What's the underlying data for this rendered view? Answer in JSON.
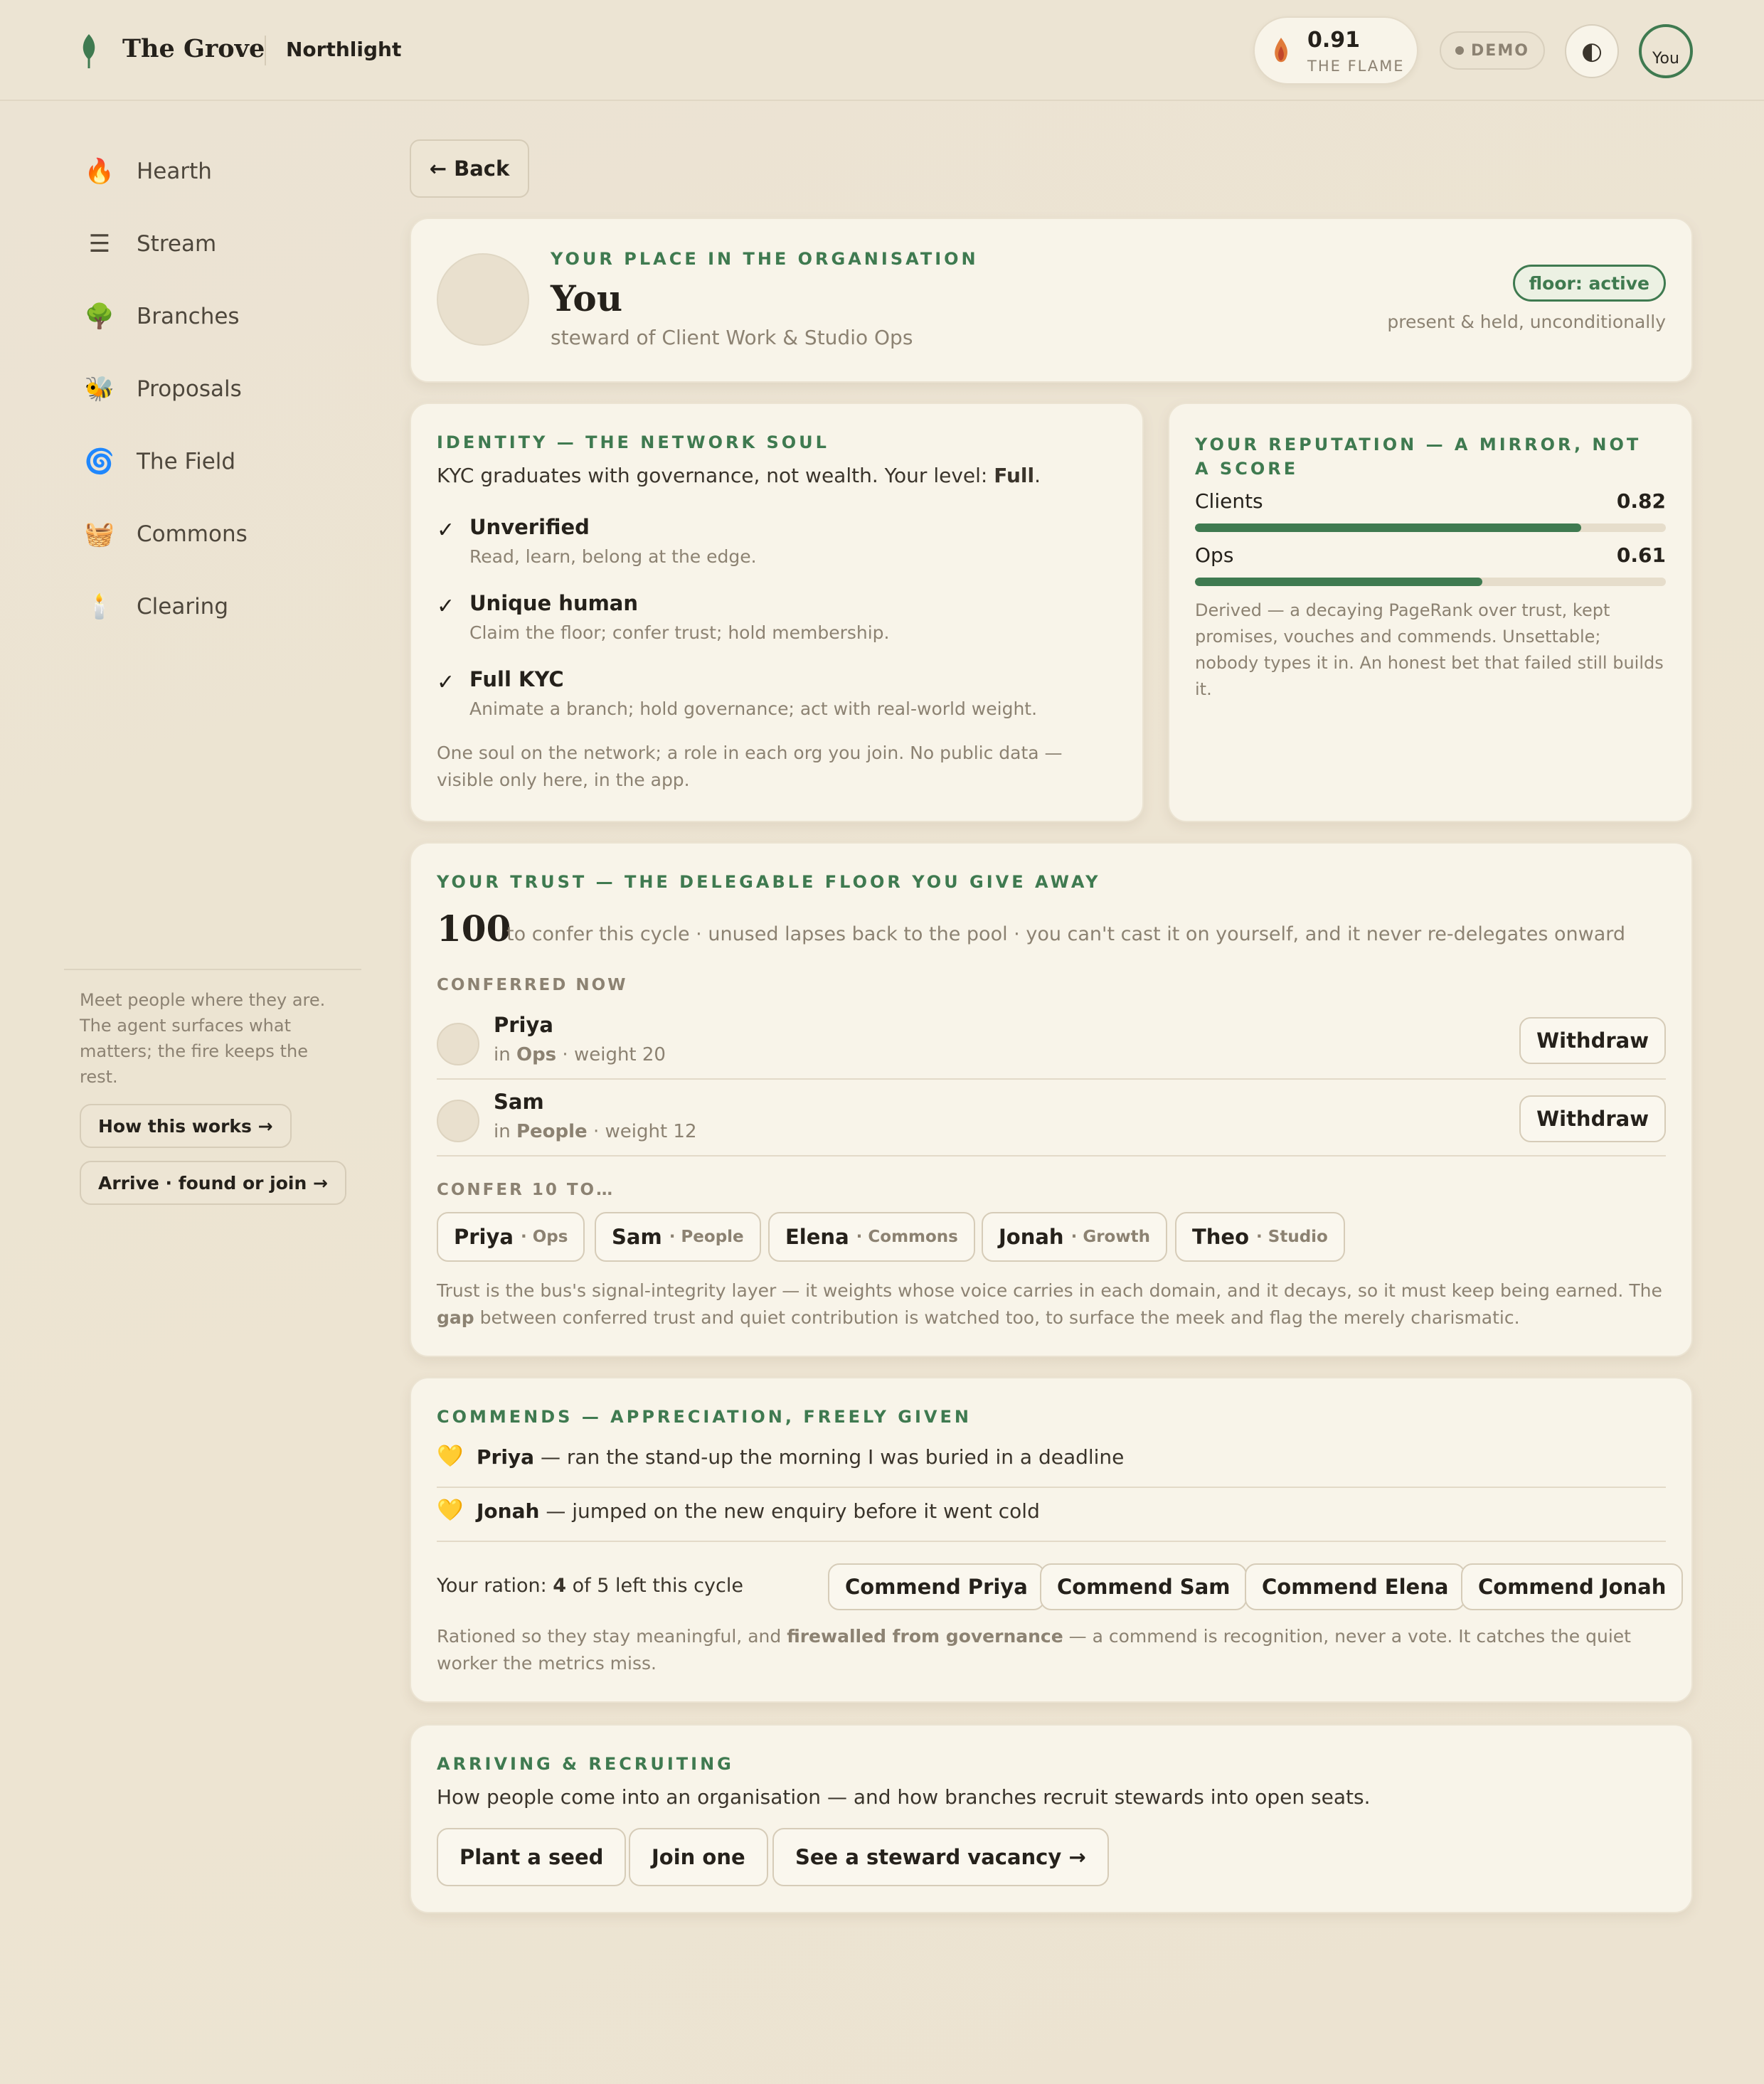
{
  "header": {
    "brand": "The Grove",
    "org": "Northlight",
    "flame_value": "0.91",
    "flame_label": "THE FLAME",
    "demo_label": "DEMO",
    "theme_icon": "◐",
    "avatar_alt": "You"
  },
  "sidebar": {
    "items": [
      {
        "icon": "🔥",
        "label": "Hearth"
      },
      {
        "icon": "☰",
        "label": "Stream"
      },
      {
        "icon": "🌳",
        "label": "Branches"
      },
      {
        "icon": "🐝",
        "label": "Proposals"
      },
      {
        "icon": "🌀",
        "label": "The Field"
      },
      {
        "icon": "🧺",
        "label": "Commons"
      },
      {
        "icon": "🕯️",
        "label": "Clearing"
      }
    ],
    "note": "Meet people where they are. The agent surfaces what matters; the fire keeps the rest.",
    "how_button": "How this works →",
    "arrive_button": "Arrive · found or join →"
  },
  "back_label": "← Back",
  "place": {
    "eyebrow": "YOUR PLACE IN THE ORGANISATION",
    "name": "You",
    "role": "steward of Client Work & Studio Ops",
    "floor_badge": "floor: active",
    "floor_note": "present & held, unconditionally"
  },
  "identity": {
    "eyebrow": "IDENTITY — THE NETWORK SOUL",
    "intro_prefix": "KYC graduates with governance, not wealth. Your level: ",
    "intro_level": "Full",
    "intro_suffix": ".",
    "levels": [
      {
        "title": "Unverified",
        "desc": "Read, learn, belong at the edge."
      },
      {
        "title": "Unique human",
        "desc": "Claim the floor; confer trust; hold membership."
      },
      {
        "title": "Full KYC",
        "desc": "Animate a branch; hold governance; act with real-world weight."
      }
    ],
    "check_glyph": "✓",
    "footer": "One soul on the network; a role in each org you join. No public data — visible only here, in the app."
  },
  "reputation": {
    "eyebrow": "YOUR REPUTATION — A MIRROR, NOT A SCORE",
    "scores": [
      {
        "label": "Clients",
        "value": "0.82",
        "fraction": 0.82
      },
      {
        "label": "Ops",
        "value": "0.61",
        "fraction": 0.61
      }
    ],
    "note": "Derived — a decaying PageRank over trust, kept promises, vouches and commends. Unsettable; nobody types it in. An honest bet that failed still builds it."
  },
  "trust": {
    "eyebrow": "YOUR TRUST — THE DELEGABLE FLOOR YOU GIVE AWAY",
    "amount": "100",
    "amount_desc": "to confer this cycle · unused lapses back to the pool · you can't cast it on yourself, and it never re-delegates onward",
    "conferred_heading": "CONFERRED NOW",
    "conferred": [
      {
        "name": "Priya",
        "in": "in ",
        "domain": "Ops",
        "weight": " · weight 20",
        "action": "Withdraw"
      },
      {
        "name": "Sam",
        "in": "in ",
        "domain": "People",
        "weight": " · weight 12",
        "action": "Withdraw"
      }
    ],
    "confer_heading": "CONFER 10 TO…",
    "candidates": [
      {
        "name": "Priya",
        "domain": "· Ops"
      },
      {
        "name": "Sam",
        "domain": "· People"
      },
      {
        "name": "Elena",
        "domain": "· Commons"
      },
      {
        "name": "Jonah",
        "domain": "· Growth"
      },
      {
        "name": "Theo",
        "domain": "· Studio"
      }
    ],
    "note_prefix": "Trust is the bus's signal-integrity layer — it weights whose voice carries in each domain, and it decays, so it must keep being earned. The ",
    "note_bold": "gap",
    "note_suffix": " between conferred trust and quiet contribution is watched too, to surface the meek and flag the merely charismatic."
  },
  "commends": {
    "eyebrow": "COMMENDS — APPRECIATION, FREELY GIVEN",
    "items": [
      {
        "icon": "💛",
        "name": "Priya",
        "text": " — ran the stand-up the morning I was buried in a deadline"
      },
      {
        "icon": "💛",
        "name": "Jonah",
        "text": " — jumped on the new enquiry before it went cold"
      }
    ],
    "ration_prefix": "Your ration: ",
    "ration_count": "4",
    "ration_suffix": " of 5 left this cycle",
    "buttons": [
      "Commend Priya",
      "Commend Sam",
      "Commend Elena",
      "Commend Jonah"
    ],
    "note_prefix": "Rationed so they stay meaningful, and ",
    "note_bold": "firewalled from governance",
    "note_suffix": " — a commend is recognition, never a vote. It catches the quiet worker the metrics miss."
  },
  "arriving": {
    "eyebrow": "ARRIVING & RECRUITING",
    "desc": "How people come into an organisation — and how branches recruit stewards into open seats.",
    "buttons": [
      "Plant a seed",
      "Join one",
      "See a steward vacancy →"
    ]
  },
  "colors": {
    "accent_green": "#3f7a50",
    "background": "#ece4d3",
    "card": "#f8f4e9",
    "muted_text": "#8c8272"
  }
}
